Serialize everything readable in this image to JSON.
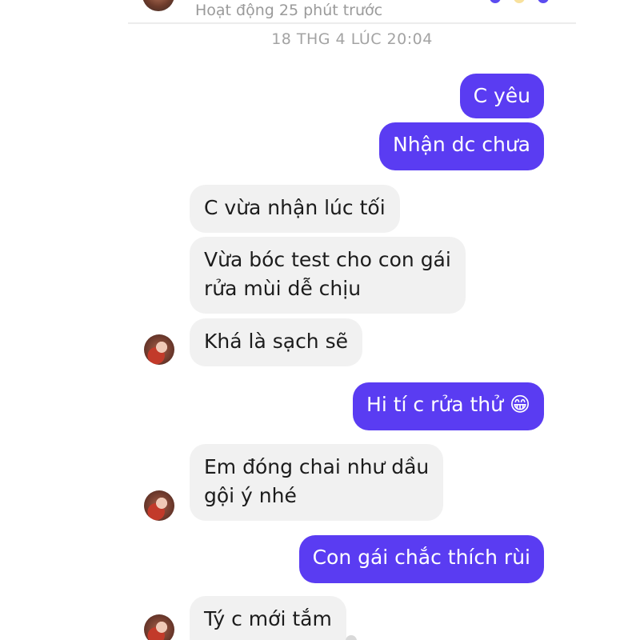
{
  "header": {
    "active_status": "Hoạt động 25 phút trước"
  },
  "timestamp": "18 THG 4 LÚC 20:04",
  "colors": {
    "sent_bubble": "#5a3cf2",
    "received_bubble": "#f1f1f1"
  },
  "messages": [
    {
      "direction": "sent",
      "text": "C yêu"
    },
    {
      "direction": "sent",
      "text": "Nhận dc chưa"
    },
    {
      "direction": "received",
      "text": "C vừa nhận lúc tối"
    },
    {
      "direction": "received",
      "lines": [
        "Vừa bóc test cho con gái",
        "rửa mùi dễ chịu"
      ]
    },
    {
      "direction": "received",
      "text": "Khá là sạch sẽ"
    },
    {
      "direction": "sent",
      "text": "Hi tí c rửa thử 😁"
    },
    {
      "direction": "received",
      "lines": [
        "Em đóng chai như dầu",
        "gội ý nhé"
      ]
    },
    {
      "direction": "sent",
      "text": "Con gái chắc thích rùi"
    },
    {
      "direction": "received",
      "text": "Tý c mới tắm"
    }
  ]
}
